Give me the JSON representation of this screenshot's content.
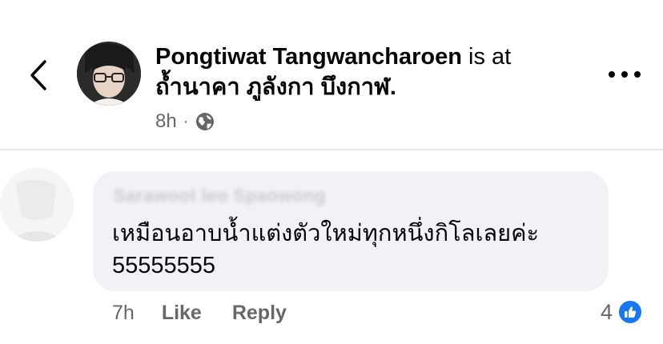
{
  "post_header": {
    "author_name": "Pongtiwat Tangwancharoen",
    "connector": "is at",
    "place": "ถ้ำนาคา ภูลังกา บึงกาฬ.",
    "time": "8h",
    "privacy_icon": "globe-icon"
  },
  "comment": {
    "commenter_name": "Sarawoot Ieo Spaowong",
    "text_line1": "เหมือนอาบน้ำแต่งตัวใหม่ทุกหนึ่งกิโลเลยค่ะ",
    "text_line2": "55555555",
    "time": "7h",
    "like_label": "Like",
    "reply_label": "Reply",
    "reaction_count": "4",
    "reaction_icon": "like-thumb-icon"
  },
  "colors": {
    "accent": "#1877f2",
    "secondary_text": "#65676b",
    "bubble_bg": "#f0f2f5"
  }
}
